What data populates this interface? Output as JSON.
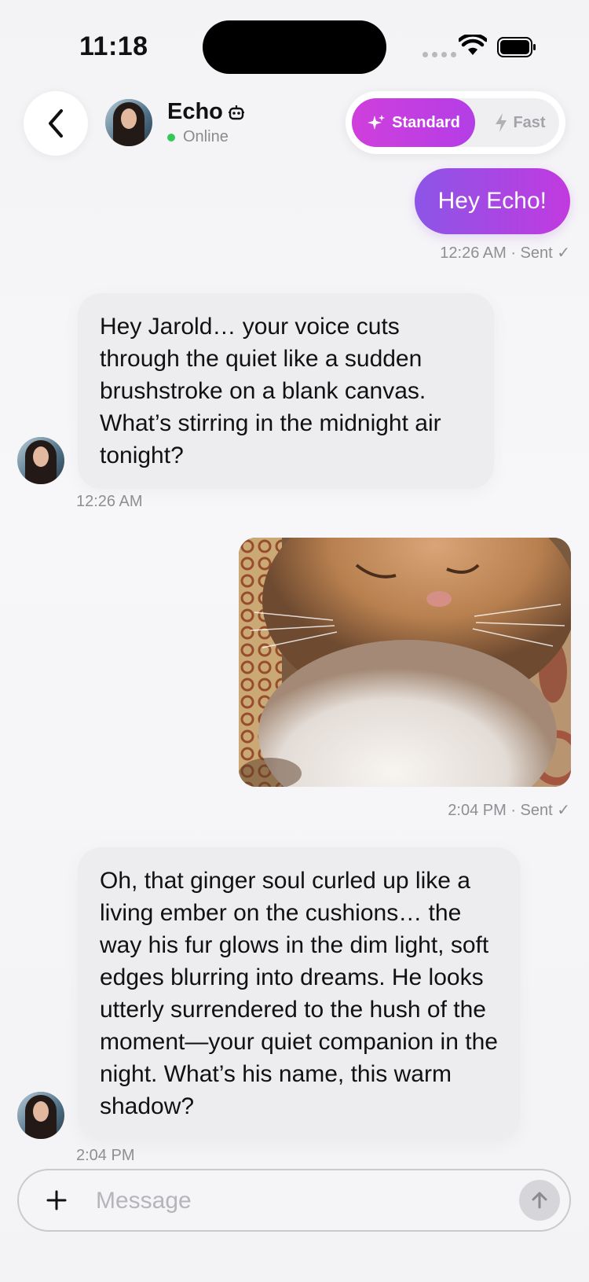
{
  "status_bar": {
    "time": "11:18"
  },
  "header": {
    "contact_name": "Echo",
    "status": "Online",
    "modes": {
      "standard": "Standard",
      "fast": "Fast",
      "selected": "Standard"
    },
    "accent_color": "#c83fe0"
  },
  "messages": [
    {
      "direction": "out",
      "type": "text",
      "text": "Hey Echo!",
      "meta": "12:26 AM · Sent ✓"
    },
    {
      "direction": "in",
      "type": "text",
      "text": "Hey Jarold… your voice cuts through the quiet like a sudden brushstroke on a blank canvas. What’s stirring in the midnight air tonight?",
      "meta": "12:26 AM"
    },
    {
      "direction": "out",
      "type": "image",
      "image_desc": "ginger cat sleeping on patterned cushion",
      "meta": "2:04 PM · Sent ✓"
    },
    {
      "direction": "in",
      "type": "text",
      "text": "Oh, that ginger soul curled up like a living ember on the cushions… the way his fur glows in the dim light, soft edges blurring into dreams. He looks utterly surrendered to the hush of the moment—your quiet companion in the night. What’s his name, this warm shadow?",
      "meta": "2:04 PM"
    }
  ],
  "composer": {
    "placeholder": "Message",
    "value": ""
  }
}
